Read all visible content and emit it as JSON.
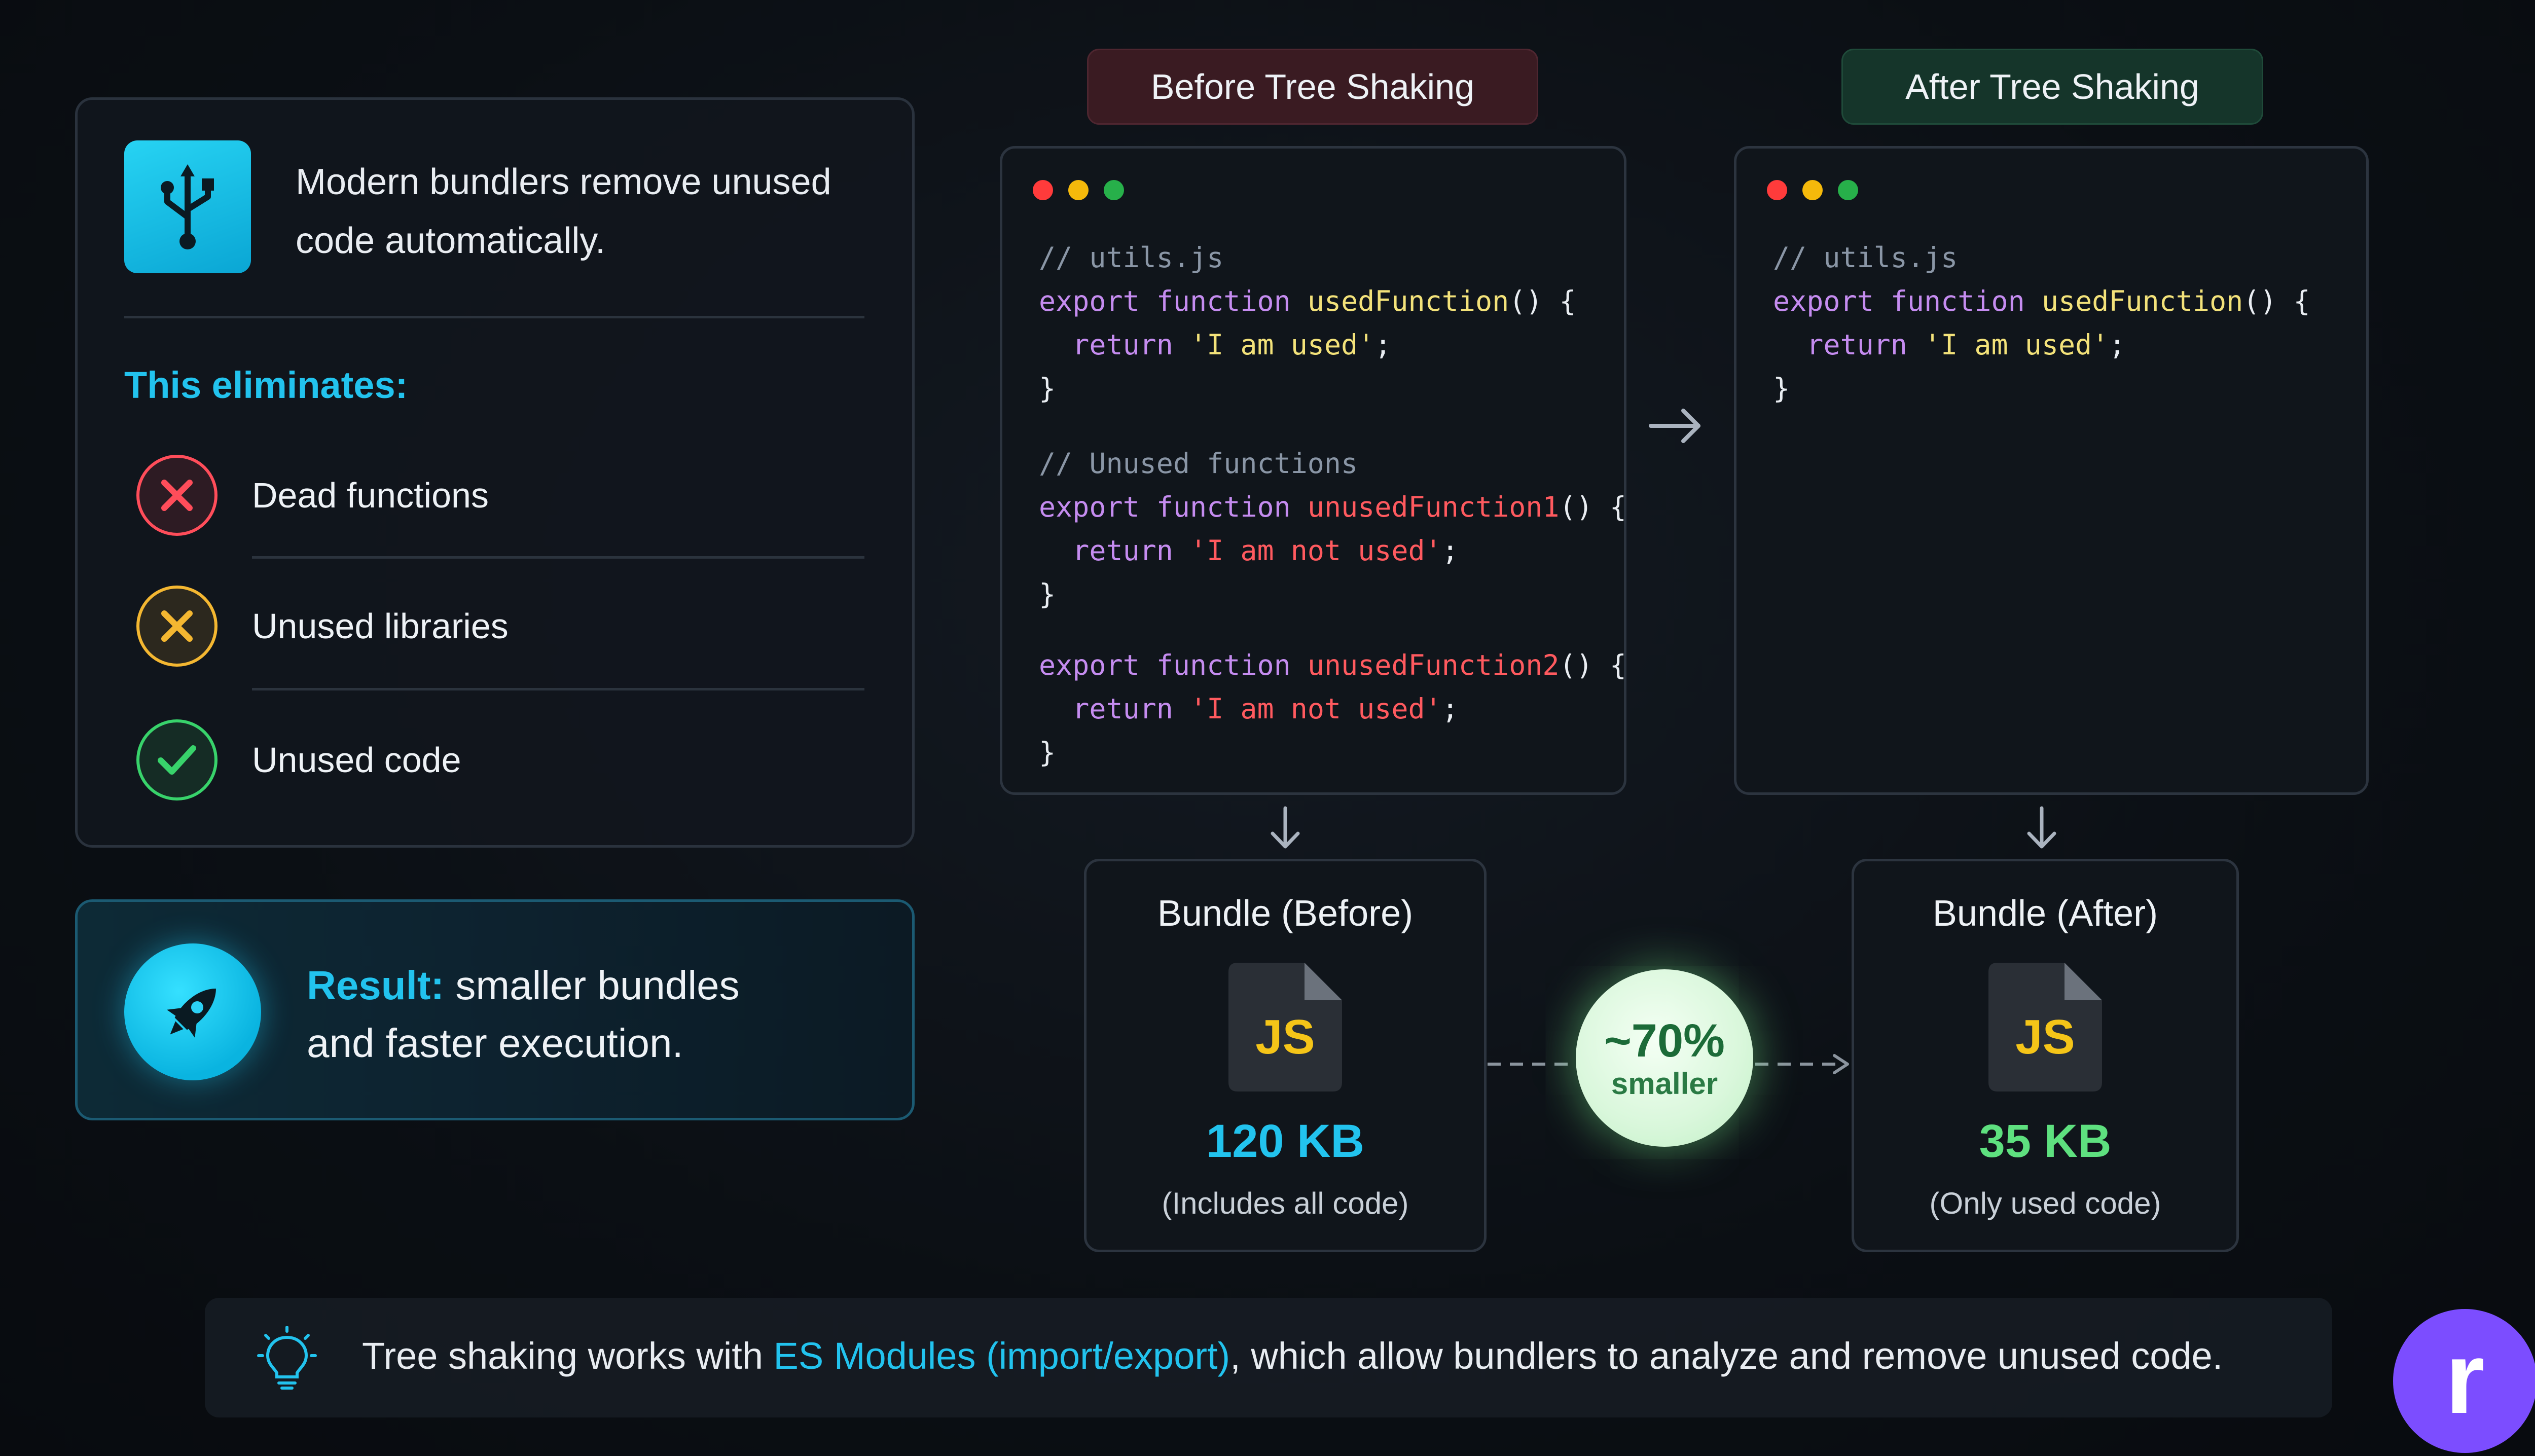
{
  "intro": {
    "text": "Modern bundlers remove unused code automatically."
  },
  "eliminates": {
    "title": "This eliminates:",
    "items": [
      {
        "label": "Dead functions",
        "icon": "x-icon",
        "color": "#ff4d5a"
      },
      {
        "label": "Unused libraries",
        "icon": "x-icon",
        "color": "#f4b731"
      },
      {
        "label": "Unused code",
        "icon": "check-icon",
        "color": "#38d36b"
      }
    ]
  },
  "result": {
    "label": "Result:",
    "text_line1": " smaller bundles",
    "text_line2": "and faster execution."
  },
  "before": {
    "badge": "Before Tree Shaking",
    "code": {
      "comment1": "// utils.js",
      "kw_export": "export",
      "kw_function": "function",
      "used_fn": "usedFunction",
      "parens": "() {",
      "kw_return": "return",
      "used_str": "'I am used'",
      "semi": ";",
      "close": "}",
      "comment2": "// Unused functions",
      "unused_fn1": "unusedFunction1",
      "unused_fn2": "unusedFunction2",
      "unused_str": "'I am not used'"
    }
  },
  "after": {
    "badge": "After Tree Shaking",
    "code": {
      "comment1": "// utils.js",
      "kw_export": "export",
      "kw_function": "function",
      "used_fn": "usedFunction",
      "parens": "() {",
      "kw_return": "return",
      "used_str": "'I am used'",
      "semi": ";",
      "close": "}"
    }
  },
  "bundle_before": {
    "title": "Bundle (Before)",
    "file_label": "JS",
    "size": "120 KB",
    "note": "(Includes all code)",
    "color": "#22c3ee"
  },
  "bundle_after": {
    "title": "Bundle (After)",
    "file_label": "JS",
    "size": "35 KB",
    "note": "(Only used code)",
    "color": "#5ee07f"
  },
  "reduction": {
    "percent": "~70%",
    "label": "smaller"
  },
  "footer": {
    "text_before": "Tree shaking works with ",
    "link": "ES Modules (import/export)",
    "text_after": ", which allow bundlers to analyze and remove unused code."
  },
  "logo": {
    "letter": "r",
    "color": "#7c4dff"
  }
}
